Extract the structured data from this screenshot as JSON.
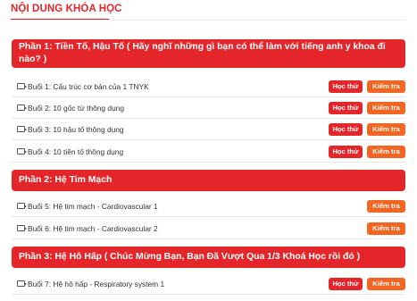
{
  "course_heading": "NỘI DUNG KHÓA HỌC",
  "sections": [
    {
      "title": "Phần 1: Tiền Tố, Hậu Tố ( Hãy nghĩ những gì bạn có thể làm với tiếng anh y khoa đi nào? )",
      "lessons": [
        {
          "title": "Buổi 1: Cấu trúc cơ bản của 1 TNYK",
          "try_label": "Học thử",
          "test_label": "Kiểm tra"
        },
        {
          "title": "Buổi 2: 10 gốc từ thông dụng",
          "try_label": "Học thử",
          "test_label": "Kiểm tra"
        },
        {
          "title": "Buổi 3: 10 hậu tố thông dụng",
          "try_label": "Học thử",
          "test_label": "Kiểm tra"
        },
        {
          "title": "Buổi 4: 10 tiền tố thông dụng",
          "try_label": "Học thử",
          "test_label": "Kiểm tra"
        }
      ]
    },
    {
      "title": "Phần 2: Hệ Tim Mạch",
      "lessons": [
        {
          "title": "Buổi 5: Hệ tim mạch - Cardiovascular 1",
          "test_label": "Kiểm tra"
        },
        {
          "title": "Buổi 6: Hệ tim mạch - Cardiovascular 2",
          "test_label": "Kiểm tra"
        }
      ]
    },
    {
      "title": "Phần 3: Hệ Hô Hấp ( Chúc Mừng Bạn, Bạn Đã Vượt Qua 1/3 Khoá Học rồi đó )",
      "lessons": [
        {
          "title": "Buổi 7: Hệ hô hấp - Respiratory system 1",
          "try_label": "Học thử",
          "test_label": "Kiểm tra"
        }
      ]
    }
  ],
  "colors": {
    "primary_red": "#e4262b",
    "test_orange": "#f26522"
  }
}
